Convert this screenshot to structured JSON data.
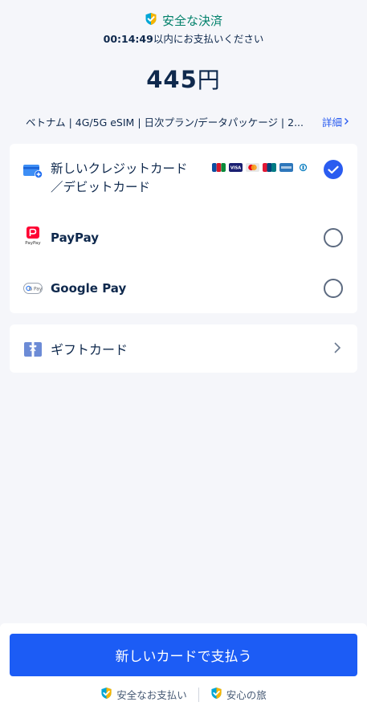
{
  "header": {
    "secure_title": "安全な決済",
    "countdown_time": "00:14:49",
    "countdown_suffix": "以内にお支払いください"
  },
  "price": {
    "amount": "445",
    "unit": "円"
  },
  "product": {
    "name": "ベトナム | 4G/5G eSIM | 日次プラン/データパッケージ | 2...",
    "details_label": "詳細"
  },
  "payment_methods": {
    "card": {
      "label_line1": "新しいクレジットカード",
      "label_line2": "／デビットカード",
      "selected": true
    },
    "paypay": {
      "label": "PayPay",
      "icon_text": "PayPay",
      "selected": false
    },
    "googlepay": {
      "label": "Google Pay",
      "icon_text": "G Pay",
      "selected": false
    }
  },
  "brand_icons": [
    "jcb-icon",
    "visa-icon",
    "mastercard-icon",
    "unionpay-icon",
    "amex-icon",
    "diners-icon"
  ],
  "gift_card": {
    "label": "ギフトカード"
  },
  "footer": {
    "cta_label": "新しいカードで支払う",
    "trust_1": "安全なお支払い",
    "trust_2": "安心の旅"
  },
  "colors": {
    "accent": "#1c5cf5",
    "secure_green": "#00806a",
    "text": "#0f294d",
    "background": "#f5f6fa"
  }
}
